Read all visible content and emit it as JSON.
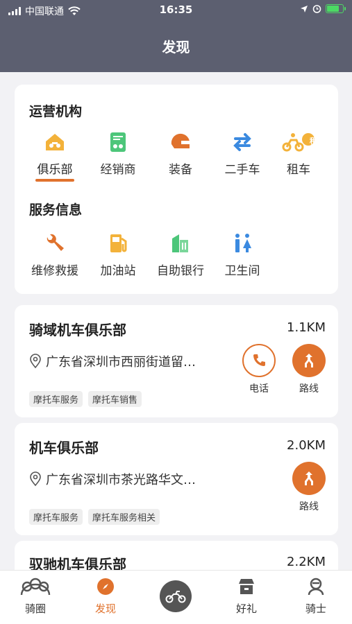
{
  "status_bar": {
    "carrier": "中国联通",
    "time": "16:35"
  },
  "header": {
    "title": "发现"
  },
  "categories": {
    "operating_title": "运营机构",
    "operating_items": [
      {
        "label": "俱乐部",
        "icon": "club-icon",
        "active": true
      },
      {
        "label": "经销商",
        "icon": "dealer-icon"
      },
      {
        "label": "装备",
        "icon": "helmet-icon"
      },
      {
        "label": "二手车",
        "icon": "swap-icon"
      },
      {
        "label": "租车",
        "icon": "rental-icon"
      }
    ],
    "rental_badge": "租",
    "service_title": "服务信息",
    "service_items": [
      {
        "label": "维修救援",
        "icon": "wrench-icon"
      },
      {
        "label": "加油站",
        "icon": "fuel-icon"
      },
      {
        "label": "自助银行",
        "icon": "bank-icon"
      },
      {
        "label": "卫生间",
        "icon": "restroom-icon"
      }
    ]
  },
  "clubs": [
    {
      "name": "骑域机车俱乐部",
      "distance": "1.1KM",
      "address": "广东省深圳市西丽街道留…",
      "tags": [
        "摩托车服务",
        "摩托车销售"
      ],
      "phone_label": "电话",
      "route_label": "路线"
    },
    {
      "name": "机车俱乐部",
      "distance": "2.0KM",
      "address": "广东省深圳市茶光路华文…",
      "tags": [
        "摩托车服务",
        "摩托车服务相关"
      ],
      "route_label": "路线"
    },
    {
      "name": "驭驰机车俱乐部",
      "distance": "2.2KM"
    }
  ],
  "tabbar": [
    {
      "label": "骑圈",
      "icon": "riders-icon"
    },
    {
      "label": "发现",
      "icon": "compass-icon",
      "active": true
    },
    {
      "label": "",
      "icon": "motorcycle-icon"
    },
    {
      "label": "好礼",
      "icon": "shop-icon"
    },
    {
      "label": "骑士",
      "icon": "rider-icon"
    }
  ],
  "colors": {
    "accent": "#e0722d",
    "header_bg": "#5c5f70",
    "page_bg": "#f2f2f5"
  }
}
